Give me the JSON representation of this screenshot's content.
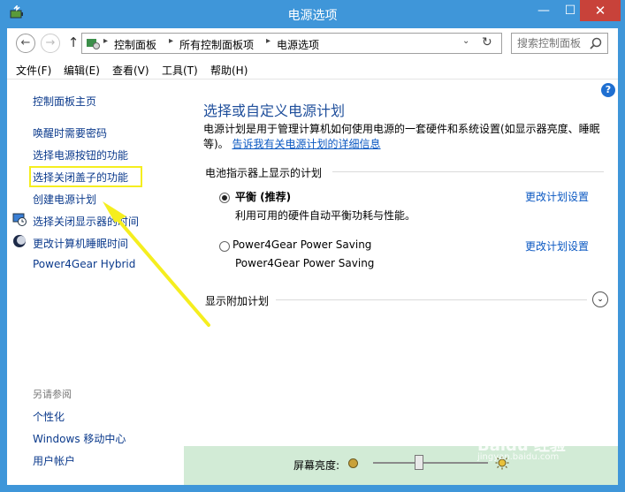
{
  "window": {
    "title": "电源选项",
    "min_glyph": "—",
    "max_glyph": "☐",
    "close_glyph": "✕"
  },
  "nav": {
    "back_glyph": "←",
    "forward_glyph": "→",
    "up_glyph": "↑",
    "breadcrumbs": [
      "控制面板",
      "所有控制面板项",
      "电源选项"
    ],
    "separator": "▸",
    "dropdown_glyph": "⌄",
    "refresh_glyph": "↻",
    "search_placeholder": "搜索控制面板"
  },
  "menu": [
    "文件(F)",
    "编辑(E)",
    "查看(V)",
    "工具(T)",
    "帮助(H)"
  ],
  "sidebar": {
    "home": "控制面板主页",
    "items": [
      "唤醒时需要密码",
      "选择电源按钮的功能",
      "选择关闭盖子的功能",
      "创建电源计划",
      "选择关闭显示器的时间",
      "更改计算机睡眠时间",
      "Power4Gear Hybrid"
    ],
    "see_also_title": "另请参阅",
    "see_also": [
      "个性化",
      "Windows 移动中心",
      "用户帐户"
    ]
  },
  "main": {
    "title": "选择或自定义电源计划",
    "description": "电源计划是用于管理计算机如何使用电源的一套硬件和系统设置(如显示器亮度、睡眠等)。",
    "learn_more": "告诉我有关电源计划的详细信息",
    "section_battery": "电池指示器上显示的计划",
    "plans": [
      {
        "name": "平衡 (推荐)",
        "desc": "利用可用的硬件自动平衡功耗与性能。",
        "selected": true
      },
      {
        "name": "Power4Gear Power Saving",
        "desc": "Power4Gear Power Saving",
        "selected": false
      }
    ],
    "change_settings": "更改计划设置",
    "section_additional": "显示附加计划",
    "expand_glyph": "⌄",
    "help_glyph": "?"
  },
  "brightness": {
    "label": "屏幕亮度:",
    "value_fraction": 0.4
  },
  "watermark": {
    "text": "Baidu 经验",
    "sub": "jingyan.baidu.com"
  },
  "colors": {
    "titlebar": "#3f96d9",
    "link": "#0b58c2",
    "heading": "#1e4e9b",
    "highlight_box": "#f5ee1f",
    "annotation_arrow": "#f5ee1f",
    "brightness_bar": "#d2ebd6",
    "close_button": "#c8423a"
  },
  "icons": {
    "app": "power-options-icon",
    "address": "control-panel-icon",
    "search": "search-icon",
    "display_time": "clock-icon",
    "sleep": "moon-icon",
    "brightness_low": "dim-sun-icon",
    "brightness_high": "bright-sun-icon"
  }
}
